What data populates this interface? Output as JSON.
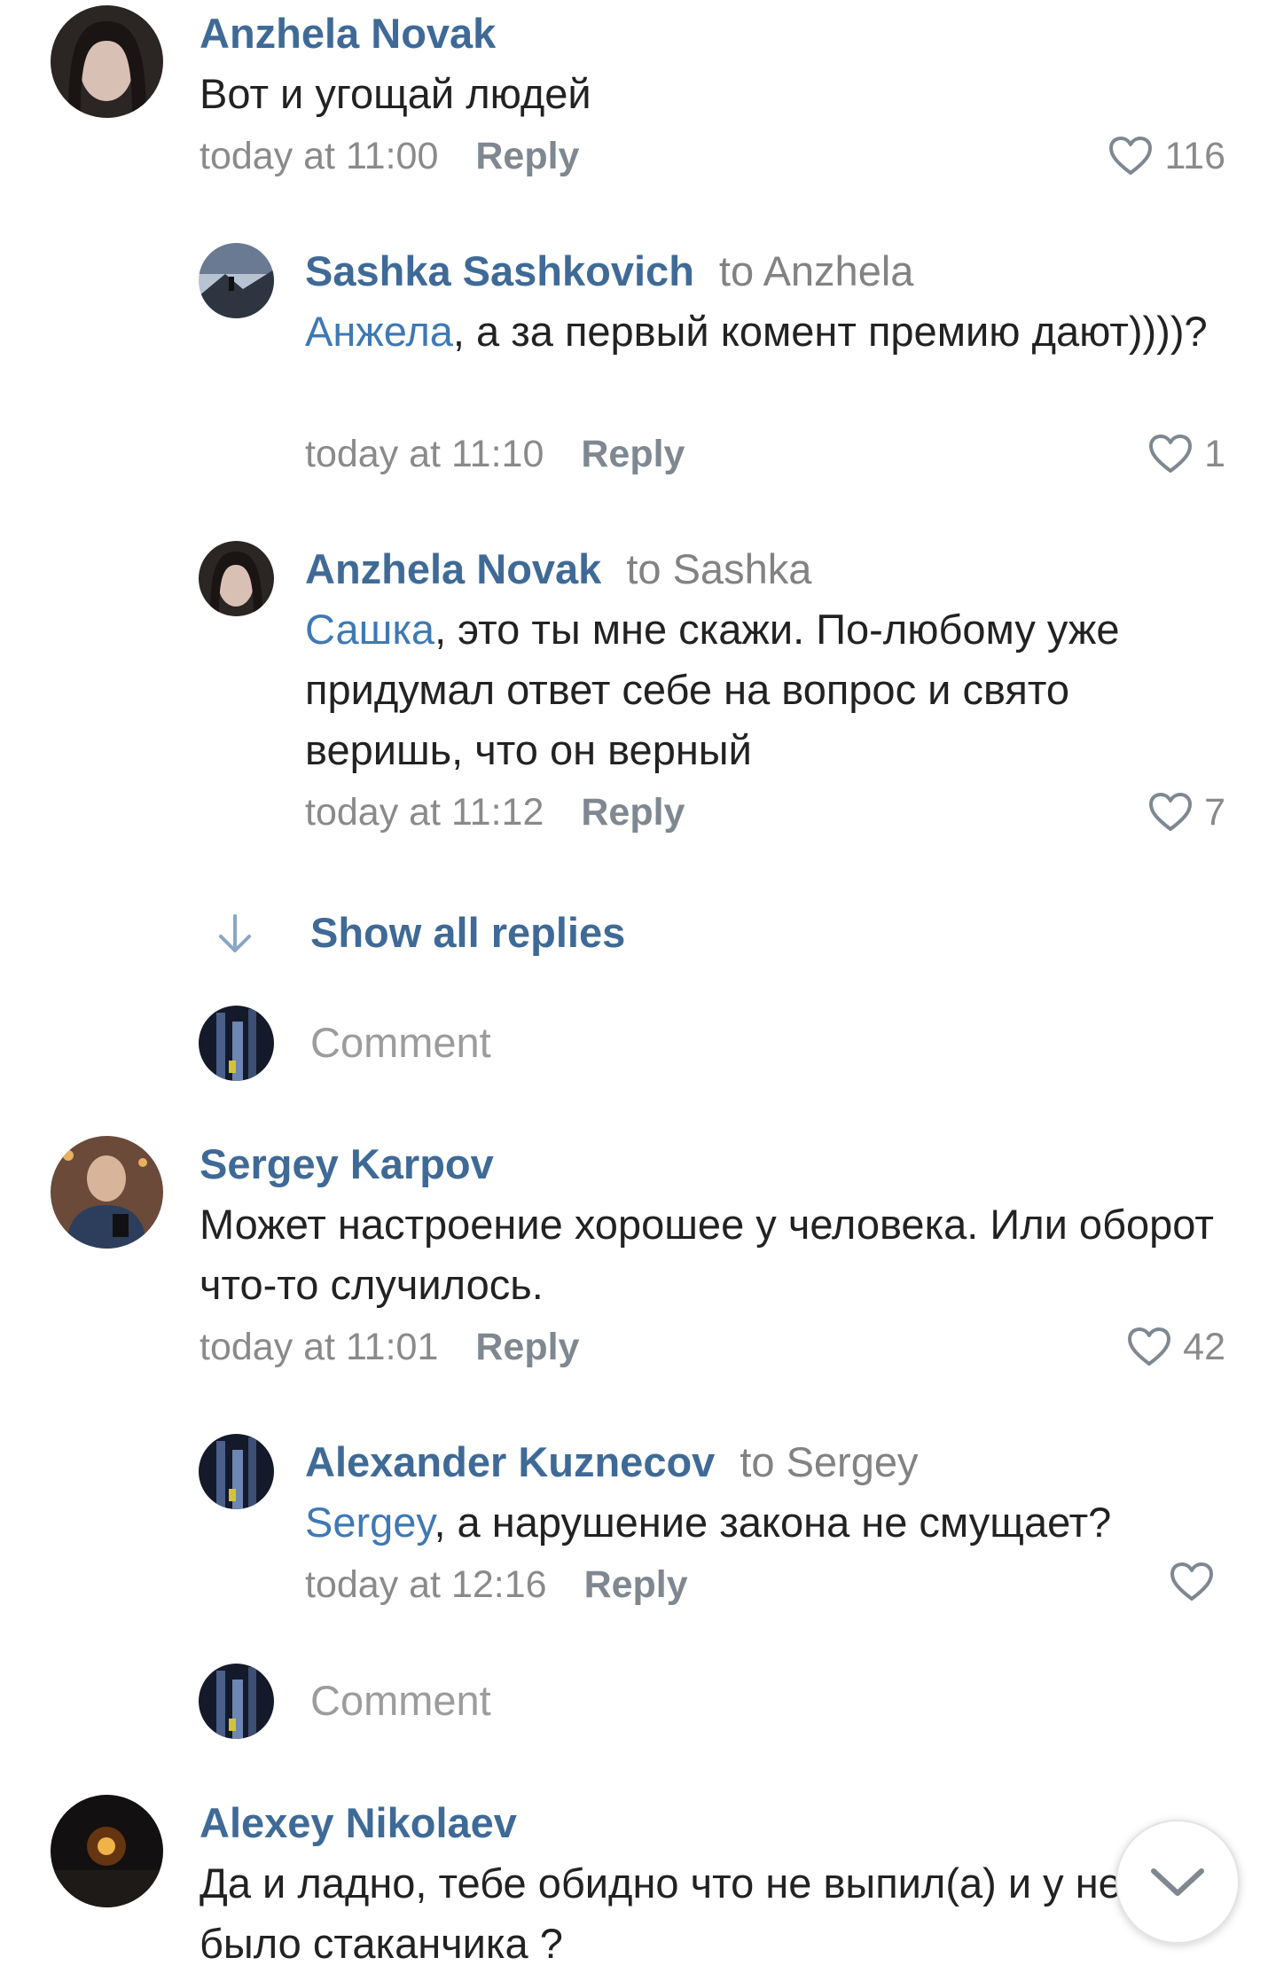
{
  "colors": {
    "link": "#3f6a97",
    "mention": "#3f79b4",
    "meta": "#8a8a8a",
    "text": "#222222"
  },
  "comments": [
    {
      "name": "Anzhela Novak",
      "text": "Вот и угощай людей",
      "time": "today at 11:00",
      "reply": "Reply",
      "likes": "116"
    },
    {
      "name": "Sashka Sashkovich",
      "to": "to Anzhela",
      "mention": "Анжела",
      "text": ", а за первый комент премию дают))))?",
      "time": "today at 11:10",
      "reply": "Reply",
      "likes": "1"
    },
    {
      "name": "Anzhela Novak",
      "to": "to Sashka",
      "mention": "Сашка",
      "text": ", это ты мне скажи. По-любому уже придумал ответ себе на вопрос и свято веришь, что он верный",
      "time": "today at 11:12",
      "reply": "Reply",
      "likes": "7"
    },
    {
      "name": "Sergey Karpov",
      "text": "Может настроение хорошее у человека. Или оборот что-то случилось.",
      "time": "today at 11:01",
      "reply": "Reply",
      "likes": "42"
    },
    {
      "name": "Alexander Kuznecov",
      "to": "to Sergey",
      "mention": "Sergey",
      "text": ", а нарушение закона не смущает?",
      "time": "today at 12:16",
      "reply": "Reply",
      "likes": ""
    },
    {
      "name": "Alexey Nikolaev",
      "text": "Да и ладно, тебе обидно что не выпил(а) и у него не было стаканчика ?"
    }
  ],
  "show_all_replies": "Show all replies",
  "comment_placeholder": "Comment",
  "icons": {
    "like": "heart-outline-icon",
    "expand": "arrow-down-icon",
    "scroll": "chevron-down-icon"
  }
}
